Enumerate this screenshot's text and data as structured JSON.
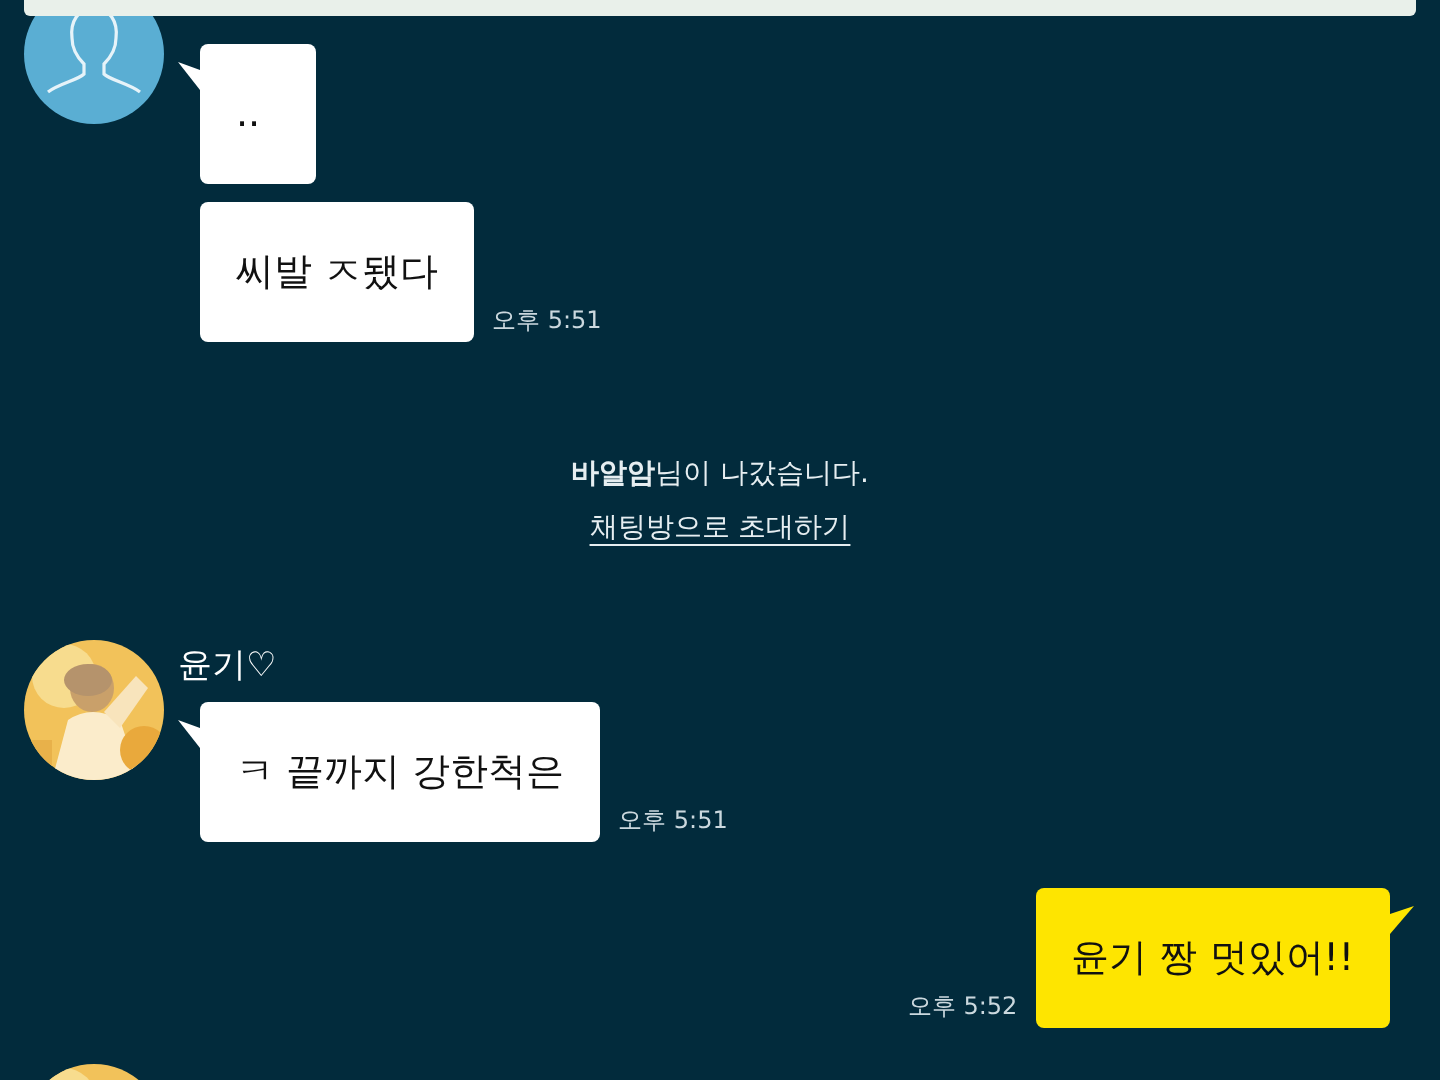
{
  "messages": [
    {
      "kind": "received",
      "avatar": {
        "kind": "silhouette"
      },
      "bubbles": [
        "..",
        "씨발 ㅈ됐다"
      ],
      "time": "오후 5:51"
    },
    {
      "kind": "system",
      "text": "**바알암**님이 나갔습니다.",
      "link": "채팅방으로 초대하기"
    },
    {
      "kind": "received",
      "avatar": {
        "kind": "picture"
      },
      "sender": "윤기♡",
      "bubbles": [
        "ㅋ 끝까지 강한척은"
      ],
      "time": "오후 5:51"
    },
    {
      "kind": "sent",
      "bubbles": [
        "윤기 짱 멋있어!!"
      ],
      "time": "오후 5:52"
    },
    {
      "kind": "received",
      "avatar": {
        "kind": "picture"
      }
    }
  ]
}
